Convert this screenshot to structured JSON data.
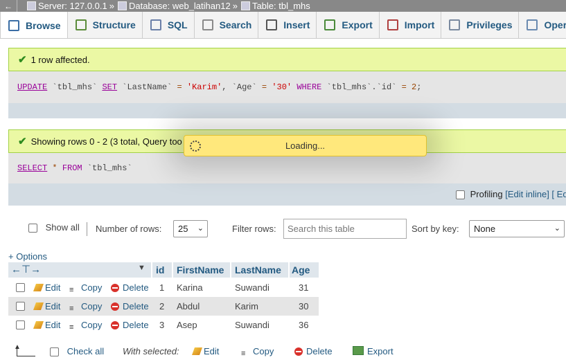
{
  "breadcrumb": {
    "server": "Server: 127.0.0.1",
    "database": "Database: web_latihan12",
    "table": "Table: tbl_mhs",
    "separator": "»"
  },
  "tabs": [
    {
      "label": "Browse",
      "icon": "browse-icon",
      "color": "#3b6ea5"
    },
    {
      "label": "Structure",
      "icon": "structure-icon",
      "color": "#5b8c3a"
    },
    {
      "label": "SQL",
      "icon": "sql-icon",
      "color": "#6a7fa8"
    },
    {
      "label": "Search",
      "icon": "search-icon",
      "color": "#8a8a8a"
    },
    {
      "label": "Insert",
      "icon": "insert-icon",
      "color": "#555555"
    },
    {
      "label": "Export",
      "icon": "export-icon",
      "color": "#4a8a3a"
    },
    {
      "label": "Import",
      "icon": "import-icon",
      "color": "#b04040"
    },
    {
      "label": "Privileges",
      "icon": "privileges-icon",
      "color": "#7a8aa0"
    },
    {
      "label": "Opera",
      "icon": "operations-icon",
      "color": "#6a8ab0"
    }
  ],
  "messages": {
    "affected": "1 row affected.",
    "showing": "Showing rows 0 - 2 (3 total, Query too"
  },
  "update_sql": {
    "kw_update": "UPDATE",
    "table": " `tbl_mhs` ",
    "kw_set": "SET",
    "col1": " `LastName` ",
    "eq": "=",
    "val1": "'Karim'",
    "comma": ", ",
    "col2": "`Age` ",
    "val2": "'30'",
    "kw_where": "WHERE",
    "cond": " `tbl_mhs`.`id` ",
    "val3": "2",
    "end": ";"
  },
  "select_sql": {
    "kw_select": "SELECT",
    "star": " * ",
    "kw_from": "FROM",
    "table": " `tbl_mhs`"
  },
  "loading": "Loading...",
  "profiling": {
    "label": "Profiling",
    "edit_inline": "[Edit inline]",
    "rest": " [ Ed"
  },
  "controls": {
    "show_all": "Show all",
    "number_of_rows_label": "Number of rows:",
    "number_of_rows_value": "25",
    "filter_label": "Filter rows:",
    "filter_placeholder": "Search this table",
    "sort_label": "Sort by key:",
    "sort_value": "None"
  },
  "options_link": "+ Options",
  "columns": [
    "id",
    "FirstName",
    "LastName",
    "Age"
  ],
  "row_actions": {
    "edit": "Edit",
    "copy": "Copy",
    "delete": "Delete"
  },
  "rows": [
    {
      "id": "1",
      "first": "Karina",
      "last": "Suwandi",
      "age": "31"
    },
    {
      "id": "2",
      "first": "Abdul",
      "last": "Karim",
      "age": "30"
    },
    {
      "id": "3",
      "first": "Asep",
      "last": "Suwandi",
      "age": "36"
    }
  ],
  "footer": {
    "check_all": "Check all",
    "with_selected": "With selected:",
    "edit": "Edit",
    "copy": "Copy",
    "delete": "Delete",
    "export": "Export"
  },
  "colors": {
    "link": "#235a81",
    "success_bg": "#ebf8a4",
    "success_border": "#a2d246",
    "loading_bg": "#ffe87c",
    "header_bg": "#dfe6ec",
    "row_alt_bg": "#e5e5e5"
  }
}
